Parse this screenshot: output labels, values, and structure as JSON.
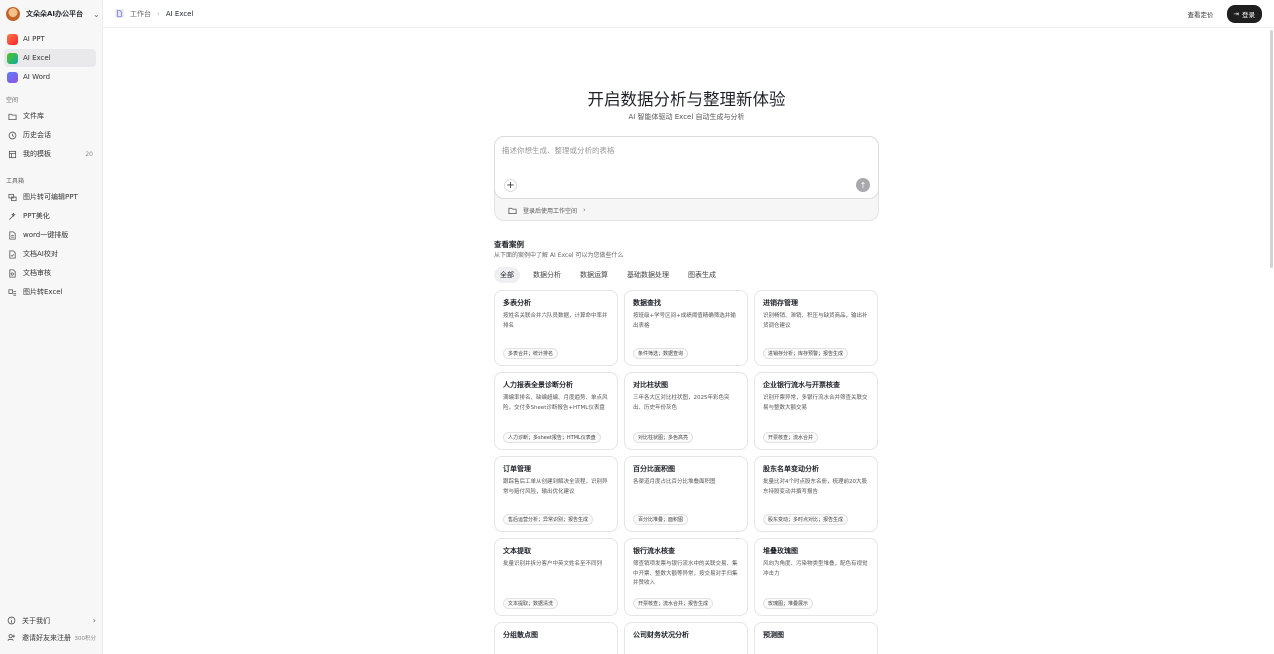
{
  "sidebar": {
    "brand": "文朵朵AI办公平台",
    "apps": [
      {
        "label": "AI PPT",
        "icon": "ppt-app-icon"
      },
      {
        "label": "AI Excel",
        "icon": "excel-app-icon"
      },
      {
        "label": "AI Word",
        "icon": "word-app-icon"
      }
    ],
    "space_label": "空间",
    "space_items": [
      {
        "label": "文件库",
        "icon": "folder-icon"
      },
      {
        "label": "历史会话",
        "icon": "history-icon"
      },
      {
        "label": "我的模板",
        "icon": "template-icon",
        "count": "20"
      }
    ],
    "tools_label": "工具箱",
    "tool_items": [
      {
        "label": "图片转可编辑PPT",
        "icon": "image-convert-icon"
      },
      {
        "label": "PPT美化",
        "icon": "beautify-icon"
      },
      {
        "label": "word一键排版",
        "icon": "document-icon"
      },
      {
        "label": "文档AI校对",
        "icon": "document-check-icon"
      },
      {
        "label": "文档审核",
        "icon": "document-review-icon"
      },
      {
        "label": "图片转Excel",
        "icon": "image-excel-icon"
      }
    ],
    "about": "关于我们",
    "invite": "邀请好友来注册",
    "invite_points": "300积分"
  },
  "topbar": {
    "crumb_root": "工作台",
    "crumb_current": "AI Excel",
    "pricing": "查看定价",
    "login": "登录"
  },
  "hero": {
    "title": "开启数据分析与整理新体验",
    "subtitle": "AI 智能体驱动 Excel 自动生成与分析"
  },
  "input": {
    "placeholder": "描述你想生成、整理或分析的表格",
    "workspace_hint": "登录后使用工作空间"
  },
  "cases": {
    "title": "查看案例",
    "subtitle": "从下面的案例中了解 AI Excel 可以为您做些什么",
    "tabs": [
      "全部",
      "数据分析",
      "数据运算",
      "基础数据处理",
      "图表生成"
    ],
    "active_tab": "全部",
    "cards": [
      {
        "title": "多表分析",
        "desc": "按姓名关联合并六队员数据，计算命中率并排名",
        "tag": "多表合并；统计排名"
      },
      {
        "title": "数据查找",
        "desc": "按班级+学号区间+成绩阈值精确筛选并输出表格",
        "tag": "条件筛选；数据查询"
      },
      {
        "title": "进销存管理",
        "desc": "识别畅销、滞销、积压与缺货商品，输出补货调仓建议",
        "tag": "进销存分析；库存预警；报告生成"
      },
      {
        "title": "人力报表全景诊断分析",
        "desc": "满编率排名、缺编超编、月度趋势、单点风险，交付多Sheet诊断报告+HTML仪表盘",
        "tag": "人力诊断；多sheet报告；HTML仪表盘"
      },
      {
        "title": "对比柱状图",
        "desc": "三年各大区对比柱状图，2025年彩色突出、历史年份灰色",
        "tag": "对比柱状图；多色高亮"
      },
      {
        "title": "企业银行流水与开票核查",
        "desc": "识别开票异常，多银行流水合并筛查关联交易与整数大额交易",
        "tag": "开票核查；流水合并"
      },
      {
        "title": "订单管理",
        "desc": "跟踪售后工单从创建到解决全流程，识别异常与赔付风险，输出优化建议",
        "tag": "售后运营分析；异常识别；报告生成"
      },
      {
        "title": "百分比面积图",
        "desc": "各渠道月度占比百分比堆叠面积图",
        "tag": "百分比堆叠；面积图"
      },
      {
        "title": "股东名单变动分析",
        "desc": "批量比对4个时点股东名册，梳理前20大股东持股变动并撰写报告",
        "tag": "股东变动；多时点对比；报告生成"
      },
      {
        "title": "文本提取",
        "desc": "批量识别并拆分客户中英文姓名至不同列",
        "tag": "文本提取；数据清洗"
      },
      {
        "title": "银行流水核查",
        "desc": "筛查销项发票与银行流水中的关联交易、集中开票、整数大额等异常，按交易对手归集并赞收入",
        "tag": "开票核查；流水合并；报告生成"
      },
      {
        "title": "堆叠玫瑰图",
        "desc": "风向为角度、污染物类型堆叠，配色有视觉冲击力",
        "tag": "玫瑰图；堆叠展示"
      },
      {
        "title": "分组散点图",
        "desc": "",
        "tag": ""
      },
      {
        "title": "公司财务状况分析",
        "desc": "",
        "tag": ""
      },
      {
        "title": "预测图",
        "desc": "",
        "tag": ""
      }
    ]
  }
}
